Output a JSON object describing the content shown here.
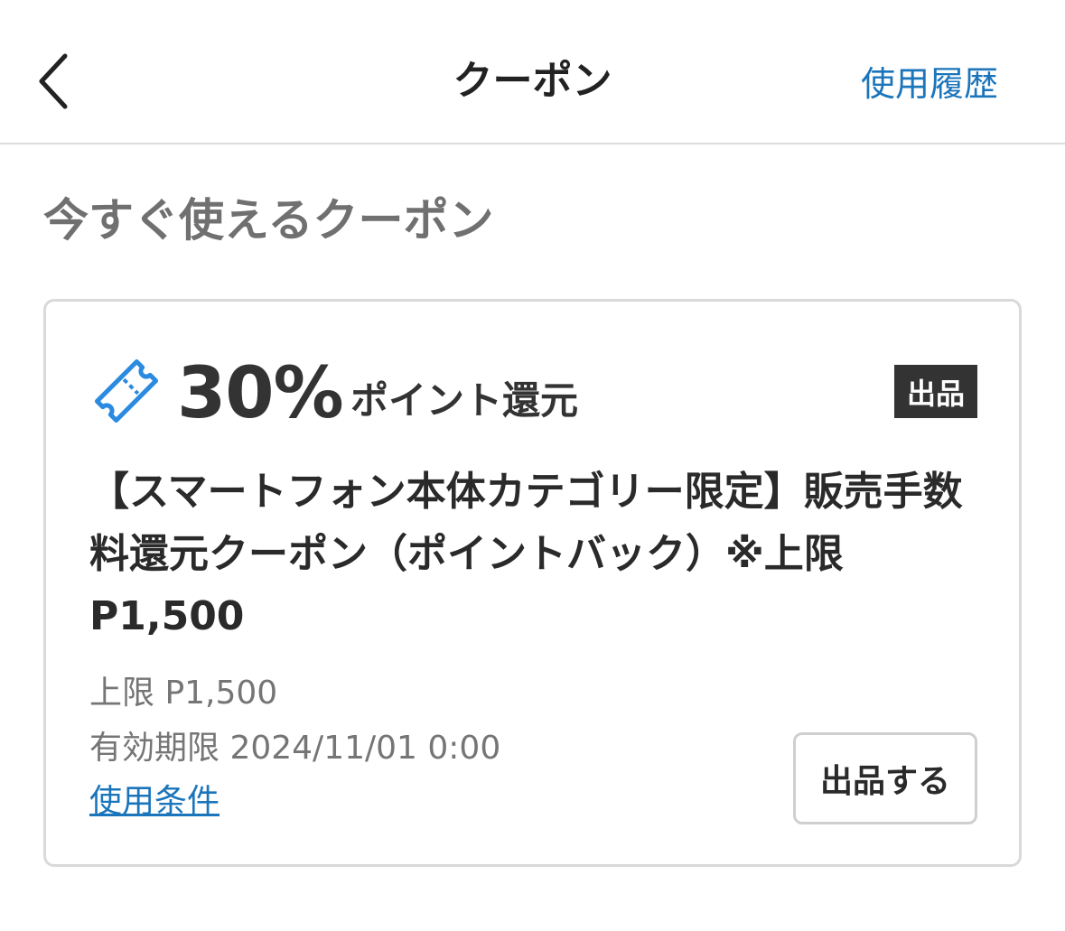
{
  "header": {
    "title": "クーポン",
    "history_link": "使用履歴",
    "back_icon": "chevron-left-icon"
  },
  "section": {
    "title": "今すぐ使えるクーポン"
  },
  "coupon": {
    "icon": "ticket-icon",
    "rate": "30%",
    "rate_suffix": "ポイント還元",
    "badge": "出品",
    "name": "【スマートフォン本体カテゴリー限定】販売手数料還元クーポン（ポイントバック）※上限P1,500",
    "limit": "上限 P1,500",
    "expiry": "有効期限 2024/11/01 0:00",
    "terms_link": "使用条件",
    "action_label": "出品する"
  },
  "colors": {
    "link": "#1b75bb",
    "badge_bg": "#333333",
    "muted_text": "#757575",
    "border": "#d9d9d9"
  }
}
